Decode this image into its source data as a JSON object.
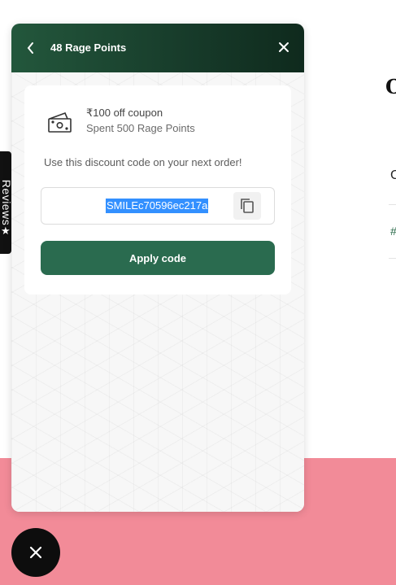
{
  "header": {
    "title": "48 Rage Points"
  },
  "coupon": {
    "title": "₹100 off coupon",
    "subtitle": "Spent 500 Rage Points",
    "hint": "Use this discount code on your next order!",
    "code": "SMILEc70596ec217a",
    "apply_label": "Apply code"
  },
  "reviews_tab": {
    "label": "Reviews"
  },
  "icons": {
    "back": "chevron-left-icon",
    "close": "close-icon",
    "coupon": "cash-icon",
    "copy": "copy-icon",
    "star": "star-icon",
    "launcher_close": "close-icon"
  },
  "colors": {
    "header_start": "#23573c",
    "header_end": "#0f2a1d",
    "accent_button": "#2a6b4f",
    "selection": "#3390ff",
    "page_band": "#f28b98"
  }
}
